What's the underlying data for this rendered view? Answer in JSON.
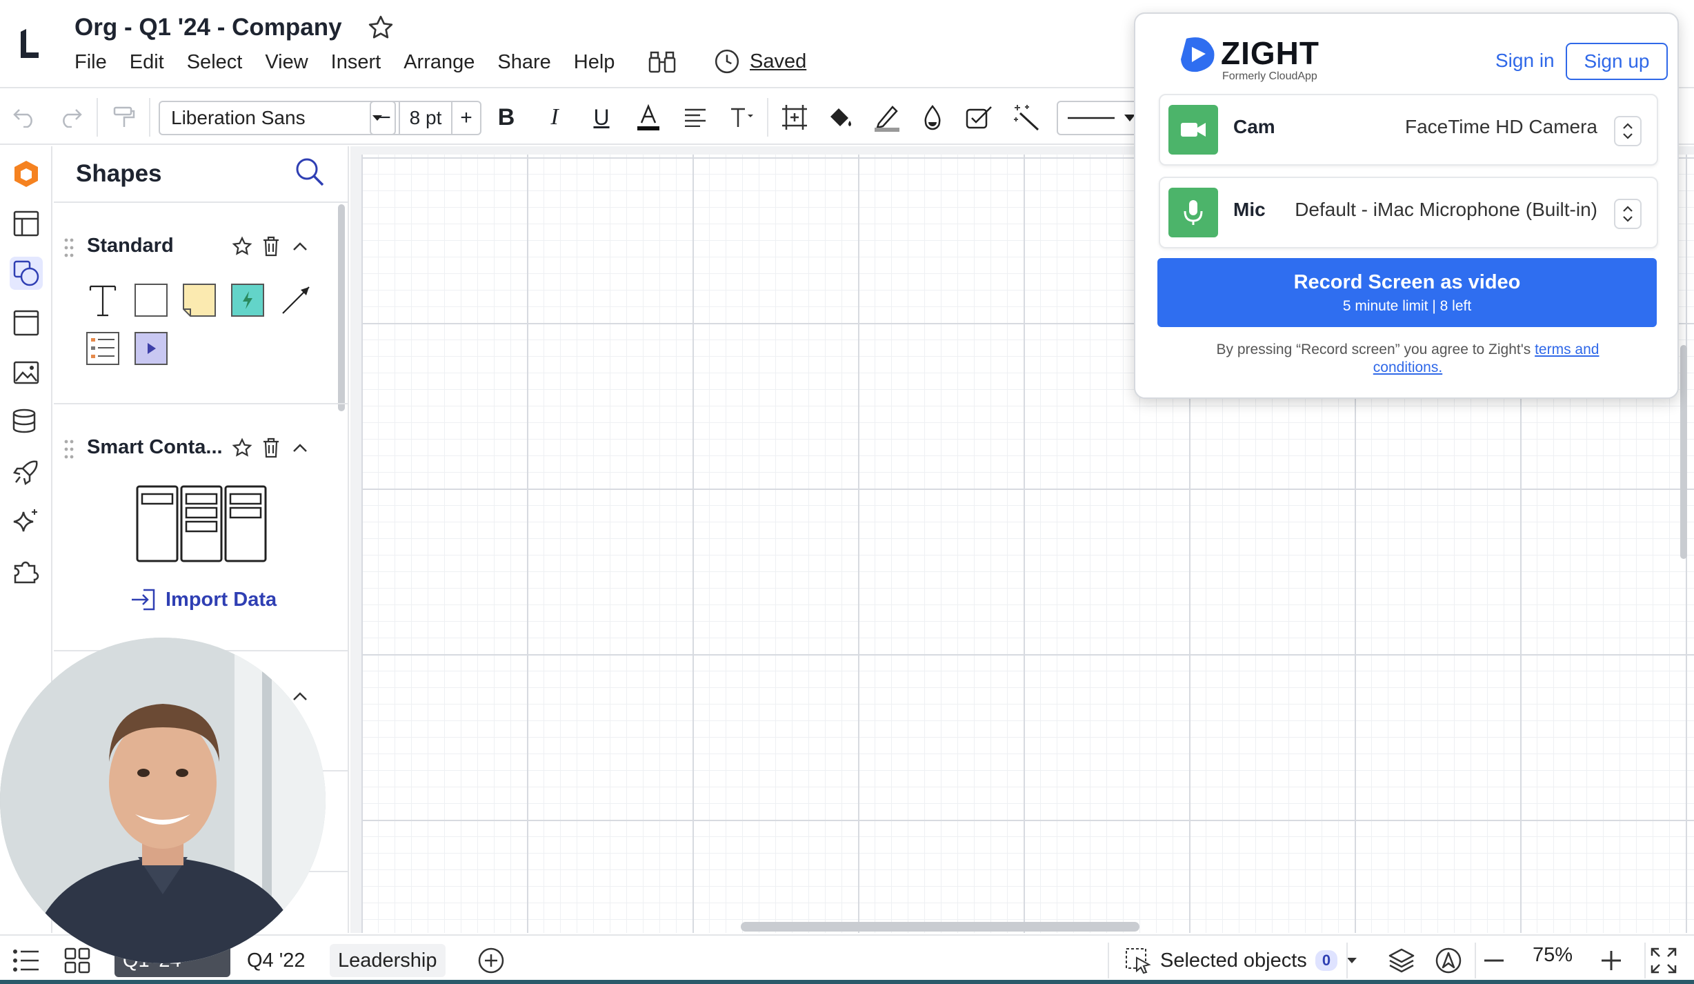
{
  "header": {
    "doc_title": "Org - Q1 '24 - Company",
    "menu": [
      "File",
      "Edit",
      "Select",
      "View",
      "Insert",
      "Arrange",
      "Share",
      "Help"
    ],
    "saved_label": "Saved"
  },
  "toolbar": {
    "font_family": "Liberation Sans",
    "font_size": "8 pt",
    "minus": "−",
    "plus": "+"
  },
  "rail": {
    "items": [
      "lucid-logo-icon",
      "layout-icon",
      "shapes-icon",
      "frame-icon",
      "image-icon",
      "data-icon",
      "rocket-icon",
      "sparkle-icon",
      "puzzle-icon"
    ]
  },
  "shapes_panel": {
    "title": "Shapes",
    "sections": [
      {
        "title": "Standard",
        "shapes": [
          "text",
          "rectangle",
          "sticky-note",
          "action-block",
          "arrow",
          "list",
          "video"
        ]
      },
      {
        "title": "Smart Conta..."
      }
    ],
    "import_label": "Import Data"
  },
  "bottombar": {
    "tabs": [
      "Q1 '24",
      "Q4 '22",
      "Leadership"
    ],
    "selected_objects_label": "Selected objects",
    "selected_count": "0",
    "zoom": "75%"
  },
  "zight": {
    "brand": "ZIGHT",
    "subtitle": "Formerly CloudApp",
    "signin": "Sign in",
    "signup": "Sign up",
    "cam_label": "Cam",
    "cam_value": "FaceTime HD Camera",
    "mic_label": "Mic",
    "mic_value": "Default - iMac Microphone (Built-in)",
    "record_title": "Record Screen as video",
    "record_sub": "5 minute limit | 8 left",
    "terms_prefix": "By pressing “Record screen” you agree to Zight's",
    "terms_link_1": "terms and",
    "terms_link_2": "conditions.",
    "accent_color": "#2f6ef0",
    "device_color": "#4cb46a"
  }
}
